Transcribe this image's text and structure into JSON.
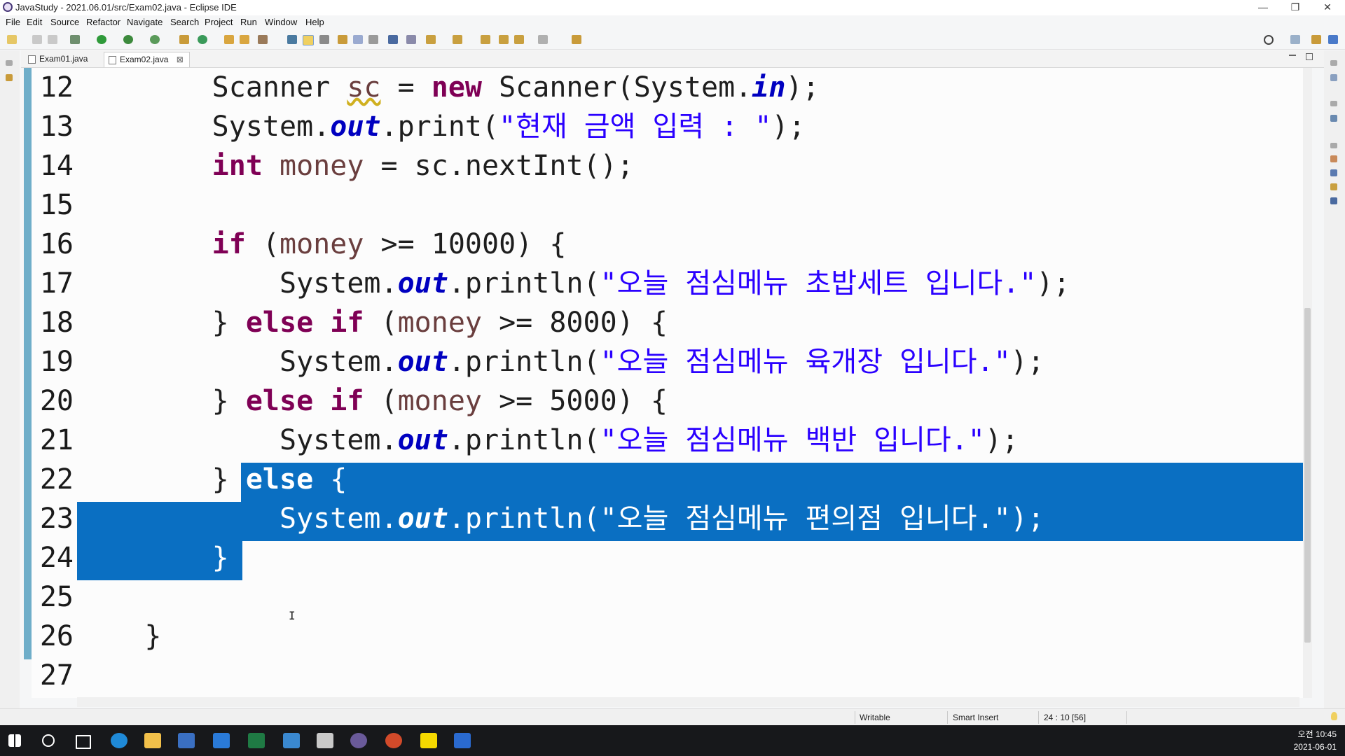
{
  "window": {
    "title": "JavaStudy - 2021.06.01/src/Exam02.java - Eclipse IDE",
    "minimize": "—",
    "restore": "❐",
    "close": "✕"
  },
  "menu": [
    "File",
    "Edit",
    "Source",
    "Refactor",
    "Navigate",
    "Search",
    "Project",
    "Run",
    "Window",
    "Help"
  ],
  "tabs": [
    {
      "label": "Exam01.java",
      "active": false
    },
    {
      "label": "Exam02.java",
      "active": true,
      "close": "⊠"
    }
  ],
  "editor": {
    "lines": [
      {
        "num": "12"
      },
      {
        "num": "13"
      },
      {
        "num": "14"
      },
      {
        "num": "15"
      },
      {
        "num": "16"
      },
      {
        "num": "17"
      },
      {
        "num": "18"
      },
      {
        "num": "19"
      },
      {
        "num": "20"
      },
      {
        "num": "21"
      },
      {
        "num": "22"
      },
      {
        "num": "23"
      },
      {
        "num": "24"
      },
      {
        "num": "25"
      },
      {
        "num": "26"
      },
      {
        "num": "27"
      }
    ],
    "tokens": {
      "l12": {
        "a": "Scanner ",
        "b": "sc",
        "c": " = ",
        "d": "new",
        "e": " Scanner(System.",
        "f": "in",
        "g": ");"
      },
      "l13": {
        "a": "System.",
        "b": "out",
        "c": ".print(",
        "d": "\"현재 금액 입력 : \"",
        "e": ");"
      },
      "l14": {
        "a": "int",
        "b": " ",
        "c": "money",
        "d": " = sc.nextInt();"
      },
      "l16": {
        "a": "if",
        "b": " (",
        "c": "money",
        "d": " >= 10000) {"
      },
      "l17": {
        "a": "System.",
        "b": "out",
        "c": ".println(",
        "d": "\"오늘 점심메뉴 초밥세트 입니다.\"",
        "e": ");"
      },
      "l18": {
        "a": "} ",
        "b": "else",
        "c": " ",
        "d": "if",
        "e": " (",
        "f": "money",
        "g": " >= 8000) {"
      },
      "l19": {
        "a": "System.",
        "b": "out",
        "c": ".println(",
        "d": "\"오늘 점심메뉴 육개장 입니다.\"",
        "e": ");"
      },
      "l20": {
        "a": "} ",
        "b": "else",
        "c": " ",
        "d": "if",
        "e": " (",
        "f": "money",
        "g": " >= 5000) {"
      },
      "l21": {
        "a": "System.",
        "b": "out",
        "c": ".println(",
        "d": "\"오늘 점심메뉴 백반 입니다.\"",
        "e": ");"
      },
      "l22": {
        "a": "}",
        "b": " ",
        "c": "else",
        "d": " {"
      },
      "l23": {
        "a": "System.",
        "b": "out",
        "c": ".println(",
        "d": "\"오늘 점심메뉴 편의점 입니다.\"",
        "e": ");"
      },
      "l24": {
        "a": "}"
      },
      "l26": {
        "a": "}"
      }
    }
  },
  "status": {
    "writable": "Writable",
    "insert_mode": "Smart Insert",
    "position": "24 : 10 [56]"
  },
  "taskbar": {
    "time": "오전 10:45",
    "date": "2021-06-01"
  },
  "colors": {
    "keyword": "#7f0055",
    "field": "#0000c0",
    "string": "#2a00ff",
    "local_var": "#6a3e3e",
    "selection": "#0a6fc2"
  }
}
